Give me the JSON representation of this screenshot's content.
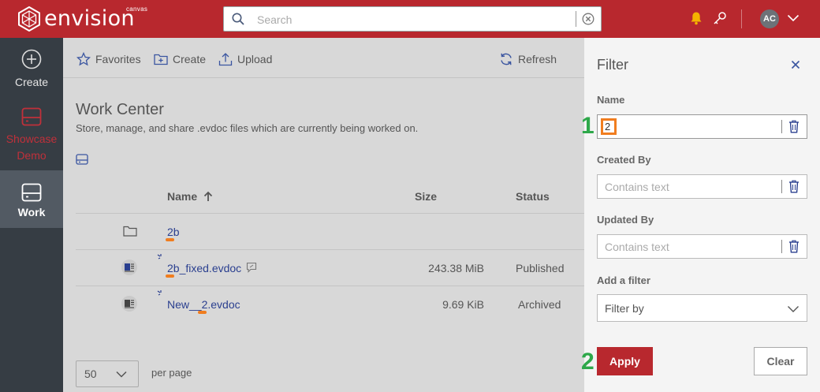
{
  "app": {
    "name": "envision",
    "sub": "canvas",
    "brand_color": "#b8282e"
  },
  "search": {
    "placeholder": "Search"
  },
  "user": {
    "initials": "AC"
  },
  "nav": {
    "items": [
      {
        "label": "Create",
        "icon": "plus-circle-icon"
      },
      {
        "label": "Showcase Demo",
        "icon": "drive-icon"
      },
      {
        "label": "Work",
        "icon": "drive-icon"
      }
    ]
  },
  "toolbar": {
    "favorites": "Favorites",
    "create": "Create",
    "upload": "Upload",
    "refresh": "Refresh"
  },
  "page": {
    "title": "Work Center",
    "subtitle": "Store, manage, and share .evdoc files which are currently being worked on."
  },
  "table": {
    "columns": {
      "name": "Name",
      "size": "Size",
      "status": "Status"
    },
    "rows": [
      {
        "name": "2b",
        "size": "",
        "status": "",
        "type": "folder"
      },
      {
        "name": "2b_fixed.evdoc",
        "size": "243.38 MiB",
        "status": "Published",
        "type": "evdoc"
      },
      {
        "name": "New__2.evdoc",
        "size": "9.69 KiB",
        "status": "Archived",
        "type": "evdoc"
      }
    ]
  },
  "pagination": {
    "page_size": "50",
    "per_page_label": "per page"
  },
  "filter": {
    "title": "Filter",
    "name_label": "Name",
    "name_value": "2",
    "created_by_label": "Created By",
    "updated_by_label": "Updated By",
    "contains_placeholder": "Contains text",
    "add_filter_label": "Add a filter",
    "filter_by": "Filter by",
    "apply": "Apply",
    "clear": "Clear"
  },
  "steps": {
    "one": "1",
    "two": "2"
  }
}
